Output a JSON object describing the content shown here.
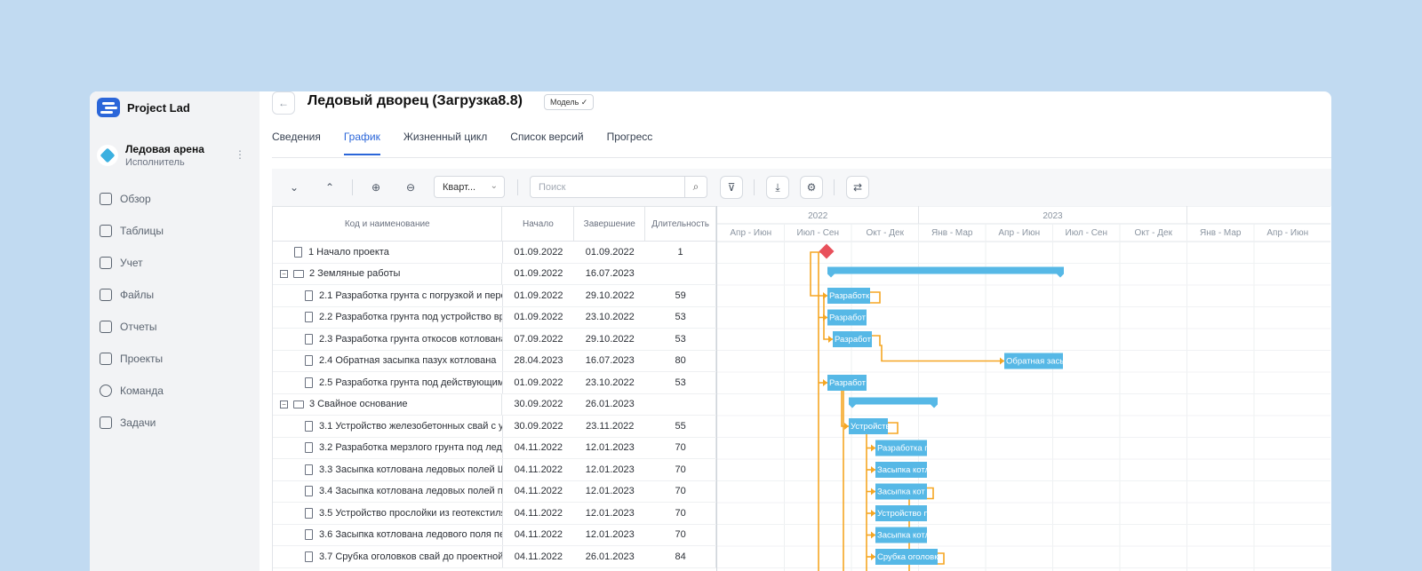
{
  "brand": {
    "name": "Project Lad"
  },
  "project": {
    "name": "Ледовая арена",
    "role": "Исполнитель",
    "more": "⋮"
  },
  "nav": [
    {
      "label": "Обзор",
      "icon": "briefcase-icon"
    },
    {
      "label": "Таблицы",
      "icon": "table-icon"
    },
    {
      "label": "Учет",
      "icon": "checkbox-icon"
    },
    {
      "label": "Файлы",
      "icon": "file-icon"
    },
    {
      "label": "Отчеты",
      "icon": "report-icon"
    },
    {
      "label": "Проекты",
      "icon": "projects-icon"
    },
    {
      "label": "Команда",
      "icon": "user-icon"
    },
    {
      "label": "Задачи",
      "icon": "tasks-icon"
    }
  ],
  "header": {
    "back": "←",
    "title": "Ледовый дворец (Загрузка8.8)",
    "badge": "Модель ✓"
  },
  "tabs": [
    "Сведения",
    "График",
    "Жизненный цикл",
    "Список версий",
    "Прогресс"
  ],
  "toolbar": {
    "expand_all": "⌄",
    "collapse_all": "⌃",
    "zoom_in": "⊕",
    "zoom_out": "⊖",
    "scale_value": "Кварт...",
    "scale_chevron": "⌄",
    "search_placeholder": "Поиск",
    "search_icon": "⌕",
    "filter": "⊽",
    "download": "⤓",
    "settings": "⚙",
    "columns": "⇄"
  },
  "table": {
    "headers": [
      "Код и наименование",
      "Начало",
      "Завершение",
      "Длительность"
    ],
    "rows": [
      {
        "type": "task",
        "level": 0,
        "name": "1 Начало проекта",
        "start": "01.09.2022",
        "end": "01.09.2022",
        "duration": "1"
      },
      {
        "type": "group",
        "level": 0,
        "toggle": "−",
        "name": "2 Земляные работы",
        "start": "01.09.2022",
        "end": "16.07.2023",
        "duration": ""
      },
      {
        "type": "task",
        "level": 1,
        "name": "2.1 Разработка грунта с погрузкой и перев",
        "start": "01.09.2022",
        "end": "29.10.2022",
        "duration": "59"
      },
      {
        "type": "task",
        "level": 1,
        "name": "2.2 Разработка грунта под устройство вре",
        "start": "01.09.2022",
        "end": "23.10.2022",
        "duration": "53"
      },
      {
        "type": "task",
        "level": 1,
        "name": "2.3 Разработка грунта откосов котлована",
        "start": "07.09.2022",
        "end": "29.10.2022",
        "duration": "53"
      },
      {
        "type": "task",
        "level": 1,
        "name": "2.4 Обратная засыпка пазух котлована",
        "start": "28.04.2023",
        "end": "16.07.2023",
        "duration": "80"
      },
      {
        "type": "task",
        "level": 1,
        "name": "2.5 Разработка грунта под действующими",
        "start": "01.09.2022",
        "end": "23.10.2022",
        "duration": "53"
      },
      {
        "type": "group",
        "level": 0,
        "toggle": "−",
        "name": "3 Свайное основание",
        "start": "30.09.2022",
        "end": "26.01.2023",
        "duration": ""
      },
      {
        "type": "task",
        "level": 1,
        "name": "3.1 Устройство железобетонных свай с учі",
        "start": "30.09.2022",
        "end": "23.11.2022",
        "duration": "55"
      },
      {
        "type": "task",
        "level": 1,
        "name": "3.2 Разработка мерзлого грунта под ледов",
        "start": "04.11.2022",
        "end": "12.01.2023",
        "duration": "70"
      },
      {
        "type": "task",
        "level": 1,
        "name": "3.3 Засыпка котлована ледовых полей ЩГ",
        "start": "04.11.2022",
        "end": "12.01.2023",
        "duration": "70"
      },
      {
        "type": "task",
        "level": 1,
        "name": "3.4 Засыпка котлована ледовых полей пес",
        "start": "04.11.2022",
        "end": "12.01.2023",
        "duration": "70"
      },
      {
        "type": "task",
        "level": 1,
        "name": "3.5 Устройство прослойки из геотекстиля ı",
        "start": "04.11.2022",
        "end": "12.01.2023",
        "duration": "70"
      },
      {
        "type": "task",
        "level": 1,
        "name": "3.6 Засыпка котлована ледового поля пес",
        "start": "04.11.2022",
        "end": "12.01.2023",
        "duration": "70"
      },
      {
        "type": "task",
        "level": 1,
        "name": "3.7 Срубка оголовков свай до проектной с",
        "start": "04.11.2022",
        "end": "26.01.2023",
        "duration": "84"
      }
    ]
  },
  "gantt": {
    "years": [
      "2022",
      "2023"
    ],
    "quarters": [
      "Апр - Июн",
      "Июл - Сен",
      "Окт - Дек",
      "Янв - Мар",
      "Апр - Июн",
      "Июл - Сен",
      "Окт - Дек",
      "Янв - Мар",
      "Апр - Июн"
    ],
    "bar_labels": [
      "Разработк",
      "Разработ",
      "Разработ",
      "Обратная засы",
      "Разработ",
      "Устройств",
      "Разработка г",
      "Засыпка котла",
      "Засыпка кот",
      "Устройство п",
      "Засыпка котл",
      "Срубка оголовк"
    ],
    "colors": {
      "bar": "#56b8e6",
      "link": "#f5a623",
      "milestone": "#e8505b",
      "accent": "#2b66d9"
    }
  }
}
